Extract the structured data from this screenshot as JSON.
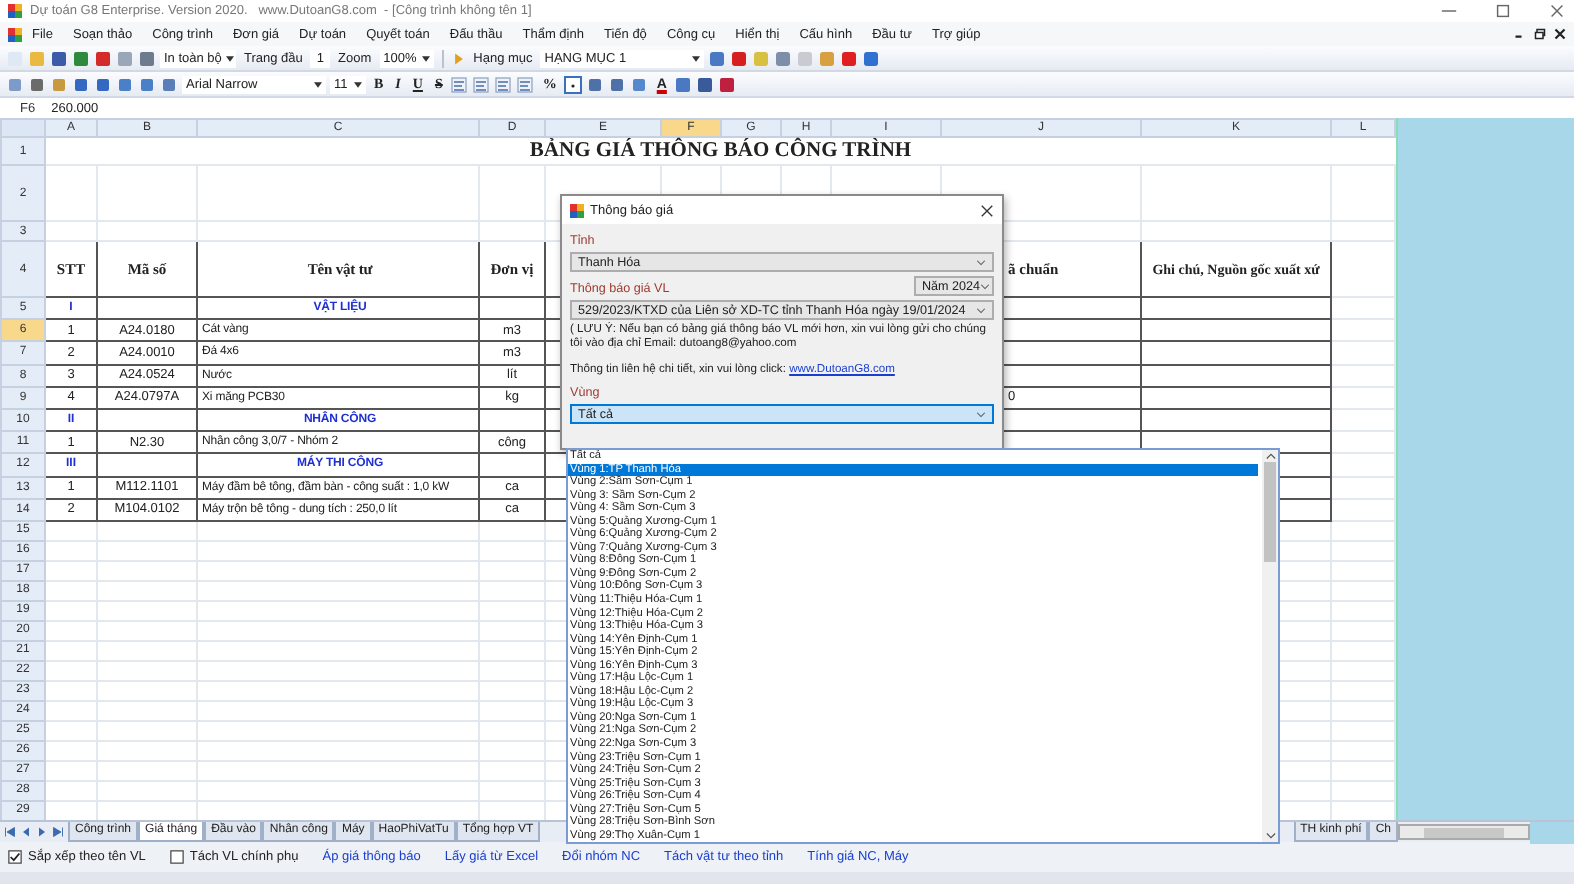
{
  "window": {
    "title": "Dự toán G8 Enterprise. Version 2020.   www.DutoanG8.com  - [Công trình không tên 1]"
  },
  "menu": [
    "File",
    "Soạn thảo",
    "Công trình",
    "Đơn giá",
    "Dự toán",
    "Quyết toán",
    "Đấu thầu",
    "Thẩm định",
    "Tiến độ",
    "Công cụ",
    "Hiển thị",
    "Cấu hình",
    "Đầu tư",
    "Trợ giúp"
  ],
  "toolbar": {
    "print_range": "In toàn bộ",
    "first_page_label": "Trang đầu",
    "first_page": "1",
    "zoom_label": "Zoom",
    "zoom": "100%",
    "item_label": "Hạng mục",
    "item": "HẠNG MỤC 1"
  },
  "format_bar": {
    "font": "Arial Narrow",
    "size": "11",
    "styles": [
      "B",
      "I",
      "U",
      "S"
    ],
    "percent": "%",
    "font_color": "A"
  },
  "formula_bar": {
    "cell": "F6",
    "value": "260.000"
  },
  "sheet": {
    "columns": [
      {
        "label": "A",
        "selected": false
      },
      {
        "label": "B",
        "selected": false
      },
      {
        "label": "C",
        "selected": false
      },
      {
        "label": "D",
        "selected": false
      },
      {
        "label": "E",
        "selected": false
      },
      {
        "label": "F",
        "selected": true
      },
      {
        "label": "G",
        "selected": false
      },
      {
        "label": "H",
        "selected": false
      },
      {
        "label": "I",
        "selected": false
      },
      {
        "label": "J",
        "selected": false
      },
      {
        "label": "K",
        "selected": false
      },
      {
        "label": "L",
        "selected": false
      }
    ],
    "rows": [
      {
        "number": "1",
        "selected": false,
        "kind": "title",
        "text": "BẢNG GIÁ THÔNG BÁO CÔNG TRÌNH"
      },
      {
        "number": "2",
        "selected": false,
        "kind": "blank"
      },
      {
        "number": "3",
        "selected": false,
        "kind": "blank"
      },
      {
        "number": "4",
        "selected": false,
        "kind": "header",
        "stt": "STT",
        "code": "Mã số",
        "name": "Tên vật tư",
        "unit": "Đơn vị",
        "column_j": "ã chuẩn",
        "column_k": "Ghi chú, Nguồn gốc xuất xứ"
      },
      {
        "number": "5",
        "selected": false,
        "kind": "section",
        "stt": "I",
        "name": "VẬT LIỆU"
      },
      {
        "number": "6",
        "selected": true,
        "kind": "item",
        "stt": "1",
        "code": "A24.0180",
        "name": "Cát vàng",
        "unit": "m3"
      },
      {
        "number": "7",
        "selected": false,
        "kind": "item",
        "stt": "2",
        "code": "A24.0010",
        "name": "Đá 4x6",
        "unit": "m3"
      },
      {
        "number": "8",
        "selected": false,
        "kind": "item",
        "stt": "3",
        "code": "A24.0524",
        "name": "Nước",
        "unit": "lít"
      },
      {
        "number": "9",
        "selected": false,
        "kind": "item",
        "stt": "4",
        "code": "A24.0797A",
        "name": "Xi măng PCB30",
        "unit": "kg",
        "column_j": "0"
      },
      {
        "number": "10",
        "selected": false,
        "kind": "section",
        "stt": "II",
        "name": "NHÂN CÔNG"
      },
      {
        "number": "11",
        "selected": false,
        "kind": "item",
        "stt": "1",
        "code": "N2.30",
        "name": "Nhân công 3,0/7 - Nhóm 2",
        "unit": "công"
      },
      {
        "number": "12",
        "selected": false,
        "kind": "section",
        "stt": "III",
        "name": "MÁY THI CÔNG"
      },
      {
        "number": "13",
        "selected": false,
        "kind": "item",
        "stt": "1",
        "code": "M112.1101",
        "name": "Máy đầm bê tông, đầm bàn - công suất : 1,0 kW",
        "unit": "ca"
      },
      {
        "number": "14",
        "selected": false,
        "kind": "item",
        "stt": "2",
        "code": "M104.0102",
        "name": "Máy trộn bê tông - dung tích : 250,0 lít",
        "unit": "ca"
      },
      {
        "number": "15",
        "selected": false,
        "kind": "blank"
      },
      {
        "number": "16",
        "selected": false,
        "kind": "blank"
      },
      {
        "number": "17",
        "selected": false,
        "kind": "blank"
      },
      {
        "number": "18",
        "selected": false,
        "kind": "blank"
      },
      {
        "number": "19",
        "selected": false,
        "kind": "blank"
      },
      {
        "number": "20",
        "selected": false,
        "kind": "blank"
      },
      {
        "number": "21",
        "selected": false,
        "kind": "blank"
      },
      {
        "number": "22",
        "selected": false,
        "kind": "blank"
      },
      {
        "number": "23",
        "selected": false,
        "kind": "blank"
      },
      {
        "number": "24",
        "selected": false,
        "kind": "blank"
      },
      {
        "number": "25",
        "selected": false,
        "kind": "blank"
      },
      {
        "number": "26",
        "selected": false,
        "kind": "blank"
      },
      {
        "number": "27",
        "selected": false,
        "kind": "blank"
      },
      {
        "number": "28",
        "selected": false,
        "kind": "blank"
      },
      {
        "number": "29",
        "selected": false,
        "kind": "blank"
      }
    ]
  },
  "sheet_tabs": {
    "left": [
      {
        "label": "Công trình",
        "selected": false
      },
      {
        "label": "Giá tháng",
        "selected": true
      },
      {
        "label": "Đầu vào",
        "selected": false
      },
      {
        "label": "Nhân công",
        "selected": false
      },
      {
        "label": "Máy",
        "selected": false
      },
      {
        "label": "HaoPhiVatTu",
        "selected": false
      },
      {
        "label": "Tổng hợp VT",
        "selected": false
      }
    ],
    "right": [
      {
        "label": "TH kinh phí",
        "selected": false
      },
      {
        "label": "Ch",
        "selected": false
      }
    ]
  },
  "options": [
    {
      "kind": "checkbox",
      "label": "Sắp xếp theo tên VL",
      "checked": true
    },
    {
      "kind": "checkbox",
      "label": "Tách VL chính phụ",
      "checked": false
    },
    {
      "kind": "link",
      "label": "Áp giá thông báo"
    },
    {
      "kind": "link",
      "label": "Lấy giá từ Excel"
    },
    {
      "kind": "link",
      "label": "Đổi nhóm NC"
    },
    {
      "kind": "link",
      "label": "Tách vật tư theo tỉnh"
    },
    {
      "kind": "link",
      "label": "Tính giá NC, Máy"
    }
  ],
  "dialog": {
    "title": "Thông báo giá",
    "province_label": "Tỉnh",
    "province": "Thanh Hóa",
    "notice_label": "Thông báo giá VL",
    "year": "Năm 2024",
    "notice": "529/2023/KTXD của Liên sở XD-TC tỉnh Thanh Hóa ngày 19/01/2024",
    "note": "( LƯU Ý: Nếu bạn có bảng giá thông báo VL mới hơn, xin vui lòng gửi cho chúng tôi vào địa chỉ Email:  dutoang8@yahoo.com",
    "contact": "Thông tin liên hệ chi tiết, xin vui lòng click:",
    "contact_link": "www.DutoanG8.com",
    "region_label": "Vùng",
    "region": "Tất cả",
    "region_options": [
      {
        "label": "Tất cả",
        "selected": false
      },
      {
        "label": "Vùng 1:TP Thanh Hóa",
        "selected": true
      },
      {
        "label": "Vùng 2:Sầm Sơn-Cụm 1",
        "selected": false
      },
      {
        "label": "Vùng 3: Sầm Sơn-Cụm 2",
        "selected": false
      },
      {
        "label": "Vùng 4: Sầm Sơn-Cụm 3",
        "selected": false
      },
      {
        "label": "Vùng 5:Quảng Xương-Cụm 1",
        "selected": false
      },
      {
        "label": "Vùng 6:Quảng Xương-Cụm 2",
        "selected": false
      },
      {
        "label": "Vùng 7:Quảng Xương-Cụm 3",
        "selected": false
      },
      {
        "label": "Vùng 8:Đông Sơn-Cụm 1",
        "selected": false
      },
      {
        "label": "Vùng 9:Đông Sơn-Cụm 2",
        "selected": false
      },
      {
        "label": "Vùng 10:Đông Sơn-Cụm 3",
        "selected": false
      },
      {
        "label": "Vùng 11:Thiệu Hóa-Cụm 1",
        "selected": false
      },
      {
        "label": "Vùng 12:Thiệu Hóa-Cụm 2",
        "selected": false
      },
      {
        "label": "Vùng 13:Thiệu Hóa-Cụm 3",
        "selected": false
      },
      {
        "label": "Vùng 14:Yên Định-Cụm 1",
        "selected": false
      },
      {
        "label": "Vùng 15:Yên Định-Cụm 2",
        "selected": false
      },
      {
        "label": "Vùng 16:Yên Định-Cụm 3",
        "selected": false
      },
      {
        "label": "Vùng 17:Hậu Lộc-Cụm 1",
        "selected": false
      },
      {
        "label": "Vùng 18:Hậu Lộc-Cụm 2",
        "selected": false
      },
      {
        "label": "Vùng 19:Hậu Lộc-Cụm 3",
        "selected": false
      },
      {
        "label": "Vùng 20:Nga Sơn-Cụm 1",
        "selected": false
      },
      {
        "label": "Vùng 21:Nga Sơn-Cụm 2",
        "selected": false
      },
      {
        "label": "Vùng 22:Nga Sơn-Cụm 3",
        "selected": false
      },
      {
        "label": "Vùng 23:Triệu Sơn-Cụm 1",
        "selected": false
      },
      {
        "label": "Vùng 24:Triệu Sơn-Cụm 2",
        "selected": false
      },
      {
        "label": "Vùng 25:Triệu Sơn-Cụm 3",
        "selected": false
      },
      {
        "label": "Vùng 26:Triệu Sơn-Cụm 4",
        "selected": false
      },
      {
        "label": "Vùng 27:Triệu Sơn-Cụm 5",
        "selected": false
      },
      {
        "label": "Vùng 28:Triệu Sơn-Bình Sơn",
        "selected": false
      },
      {
        "label": "Vùng 29:Thọ Xuân-Cụm 1",
        "selected": false
      }
    ]
  }
}
